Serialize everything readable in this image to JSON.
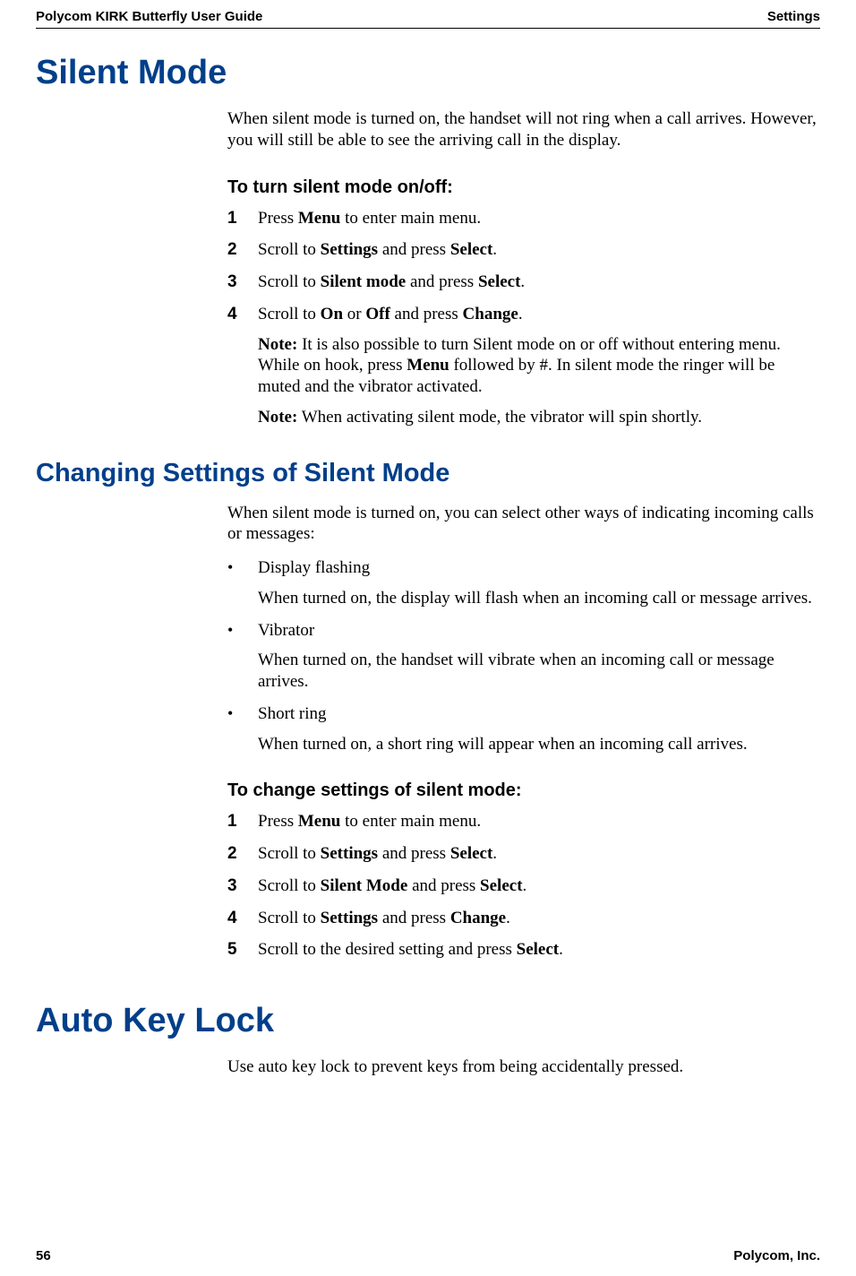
{
  "header": {
    "left": "Polycom KIRK Butterfly User Guide",
    "right": "Settings"
  },
  "footer": {
    "left": "56",
    "right": "Polycom, Inc."
  },
  "h1_silent": "Silent Mode",
  "intro": {
    "p1": "When silent mode is turned on, the handset will not ring when a call arrives. However, you will still be able to see the arriving call in the display."
  },
  "toggle": {
    "heading": "To turn silent mode on/off:",
    "steps": {
      "s1": {
        "pre": "Press ",
        "b1": "Menu",
        "post": " to enter main menu."
      },
      "s2": {
        "pre": "Scroll to ",
        "b1": "Settings",
        "mid": " and press ",
        "b2": "Select",
        "post": "."
      },
      "s3": {
        "pre": "Scroll to ",
        "b1": "Silent mode",
        "mid": " and press ",
        "b2": "Select",
        "post": "."
      },
      "s4": {
        "pre": "Scroll to ",
        "b1": "On",
        "mid1": " or ",
        "b2": "Off",
        "mid2": " and press ",
        "b3": "Change",
        "post": "."
      }
    },
    "note1": {
      "label": "Note:",
      "pre": " It is also possible to turn Silent mode on or off without entering menu. While on hook, press ",
      "b1": "Menu",
      "post": " followed by #. In silent mode the ringer will be muted and the vibrator activated."
    },
    "note2": {
      "label": "Note:",
      "text": " When activating silent mode, the vibrator will spin shortly."
    }
  },
  "h2_changing": "Changing Settings of Silent Mode",
  "changing_intro": "When silent mode is turned on, you can select other ways of indicating incoming calls or messages:",
  "bullets": {
    "b1": {
      "title": "Display flashing",
      "desc": "When turned on, the display will flash when an incoming call or message arrives."
    },
    "b2": {
      "title": "Vibrator",
      "desc": "When turned on, the handset will vibrate when an incoming call or message arrives."
    },
    "b3": {
      "title": "Short ring",
      "desc": "When turned on, a short ring will appear when an incoming call arrives."
    }
  },
  "change": {
    "heading": "To change settings of silent mode:",
    "steps": {
      "s1": {
        "pre": "Press ",
        "b1": "Menu",
        "post": " to enter main menu."
      },
      "s2": {
        "pre": "Scroll to ",
        "b1": "Settings",
        "mid": " and press ",
        "b2": "Select",
        "post": "."
      },
      "s3": {
        "pre": "Scroll to ",
        "b1": "Silent Mode",
        "mid": " and press ",
        "b2": "Select",
        "post": "."
      },
      "s4": {
        "pre": "Scroll to ",
        "b1": "Settings",
        "mid": " and press ",
        "b2": "Change",
        "post": "."
      },
      "s5": {
        "pre": "Scroll to the desired setting and press ",
        "b1": "Select",
        "post": "."
      }
    }
  },
  "h1_auto": "Auto Key Lock",
  "auto_text": "Use auto key lock to prevent keys from being accidentally pressed."
}
